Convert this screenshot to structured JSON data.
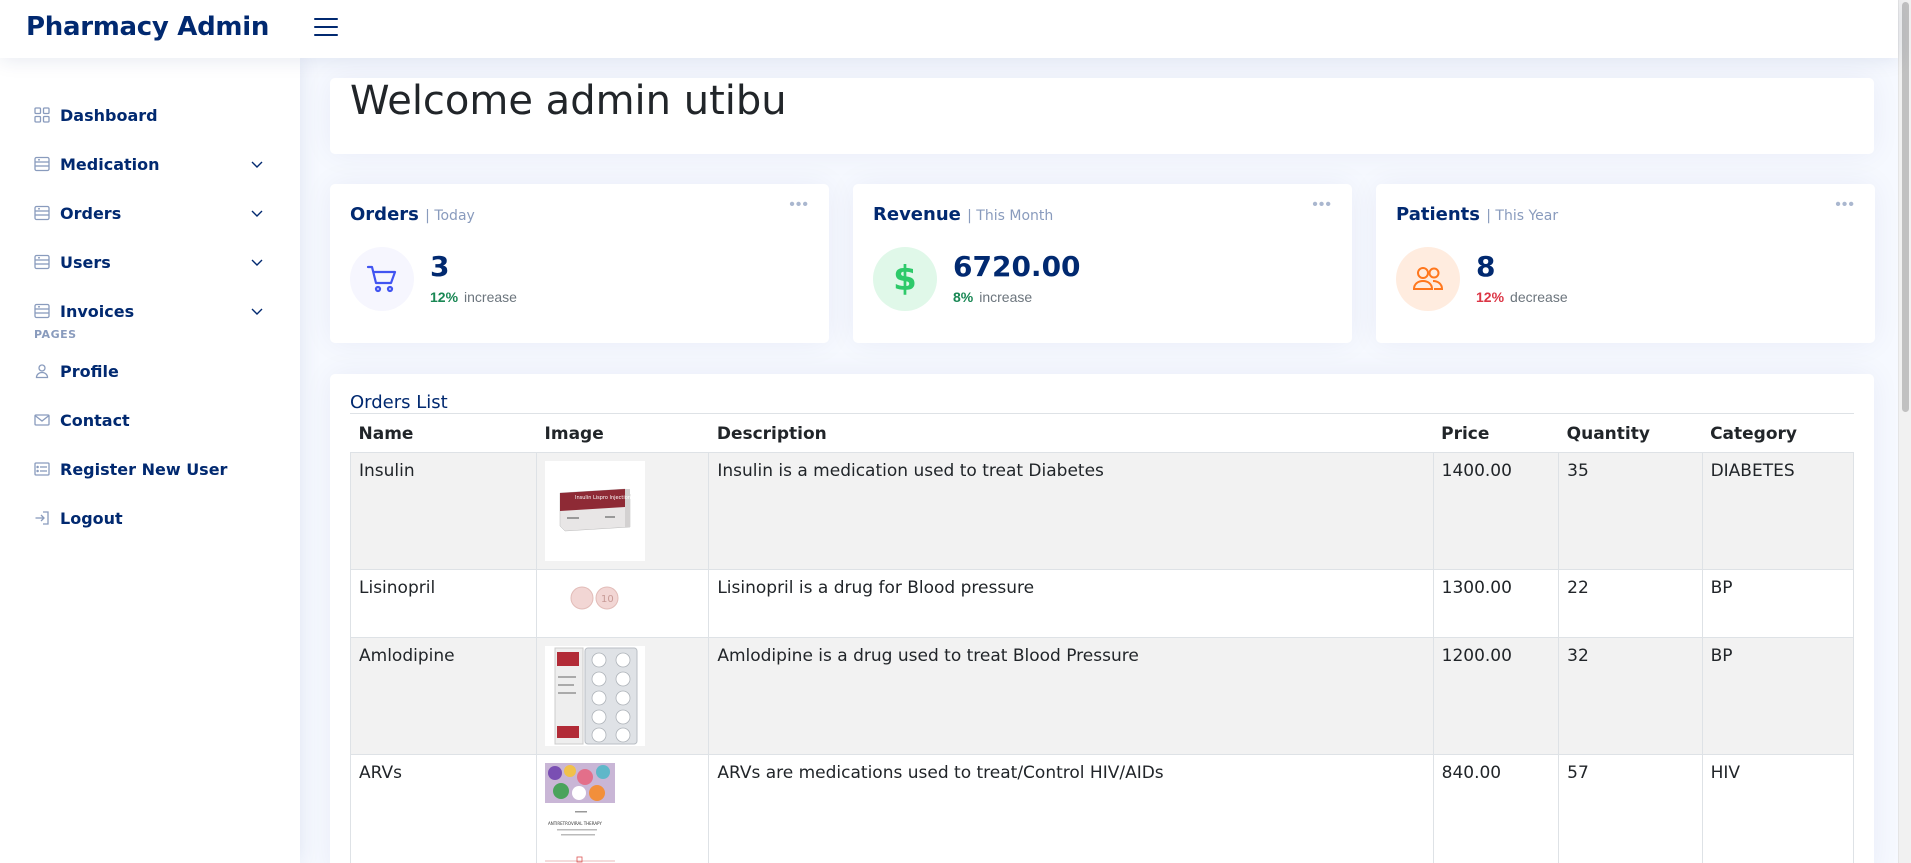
{
  "app": {
    "title": "Pharmacy Admin"
  },
  "sidebar": {
    "items": [
      {
        "label": "Dashboard"
      },
      {
        "label": "Medication"
      },
      {
        "label": "Orders"
      },
      {
        "label": "Users"
      },
      {
        "label": "Invoices"
      }
    ],
    "section_heading": "PAGES",
    "pages": [
      {
        "label": "Profile"
      },
      {
        "label": "Contact"
      },
      {
        "label": "Register New User"
      },
      {
        "label": "Logout"
      }
    ]
  },
  "welcome": {
    "title": "Welcome admin utibu"
  },
  "stats": [
    {
      "title": "Orders",
      "period": "| Today",
      "value": "3",
      "pct": "12%",
      "direction": "increase",
      "pct_color": "#198754",
      "icon": "cart-icon"
    },
    {
      "title": "Revenue",
      "period": "| This Month",
      "value": "6720.00",
      "pct": "8%",
      "direction": "increase",
      "pct_color": "#198754",
      "icon": "dollar-icon"
    },
    {
      "title": "Patients",
      "period": "| This Year",
      "value": "8",
      "pct": "12%",
      "direction": "decrease",
      "pct_color": "#dc3545",
      "icon": "people-icon"
    }
  ],
  "orders": {
    "title": "Orders List",
    "headers": {
      "name": "Name",
      "image": "Image",
      "description": "Description",
      "price": "Price",
      "quantity": "Quantity",
      "category": "Category"
    },
    "rows": [
      {
        "name": "Insulin",
        "description": "Insulin is a medication used to treat Diabetes",
        "price": "1400.00",
        "quantity": "35",
        "category": "DIABETES",
        "image_text": "Insulin Lispro Injection"
      },
      {
        "name": "Lisinopril",
        "description": "Lisinopril is a drug for Blood pressure",
        "price": "1300.00",
        "quantity": "22",
        "category": "BP",
        "image_text": "10"
      },
      {
        "name": "Amlodipine",
        "description": "Amlodipine is a drug used to treat Blood Pressure",
        "price": "1200.00",
        "quantity": "32",
        "category": "BP"
      },
      {
        "name": "ARVs",
        "description": "ARVs are medications used to treat/Control HIV/AIDs",
        "price": "840.00",
        "quantity": "57",
        "category": "HIV",
        "image_text": "ANTIRETROVIRAL THERAPY"
      }
    ]
  },
  "colors": {
    "brand": "#012970",
    "accent": "#4154f1",
    "revenue": "#2eca6a",
    "patients": "#ff771d"
  }
}
